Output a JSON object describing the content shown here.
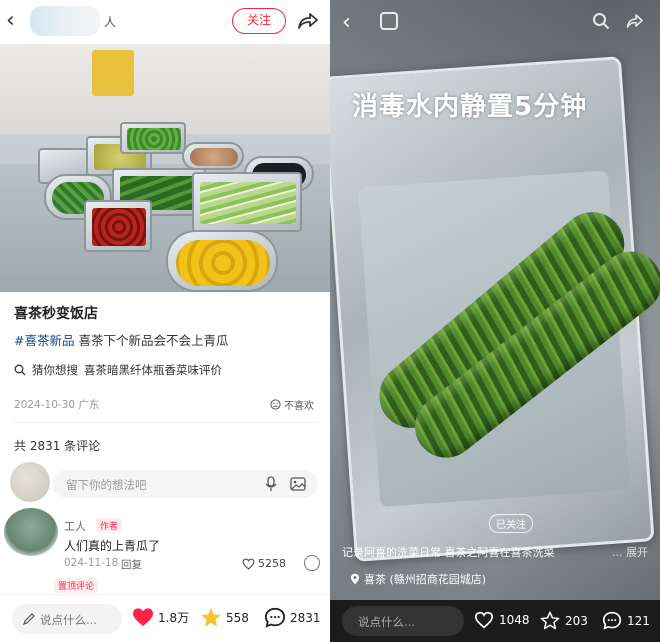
{
  "left": {
    "header": {
      "author": "人",
      "follow_label": "关注"
    },
    "post": {
      "title": "喜茶秒变饭店",
      "hashtag": "#喜茶新品",
      "body": "喜茶下个新品会不会上青瓜",
      "guess_head": "猜你想搜",
      "guess_item": "喜茶暗黑纤体瓶香菜味评价",
      "date_location": "2024-10-30 广东",
      "dislike_label": "不喜欢"
    },
    "comments": {
      "count_label": "共 2831 条评论",
      "input_placeholder": "留下你的想法吧",
      "items": [
        {
          "name": "工人",
          "author_badge": "作者",
          "text": "人们真的上青瓜了",
          "date": "024-11-18",
          "reply_label": "回复",
          "likes": "5258",
          "pin_badge": "置顶评论"
        }
      ]
    },
    "bottom": {
      "input_placeholder": "说点什么...",
      "likes": "1.8万",
      "favorites": "558",
      "comments": "2831"
    }
  },
  "right": {
    "overlay_title": "消毒水内静置5分钟",
    "follow_label": "已关注",
    "caption": "记录阿喜的洗菜日常 喜茶之阿喜在喜茶洗菜",
    "caption_more": "... 展开",
    "location": "喜茶 (赣州招商花园城店)",
    "bottom": {
      "input_placeholder": "说点什么...",
      "likes": "1048",
      "favorites": "203",
      "comments": "121"
    }
  },
  "colors": {
    "accent": "#ff2442",
    "tag": "#134a8e"
  }
}
